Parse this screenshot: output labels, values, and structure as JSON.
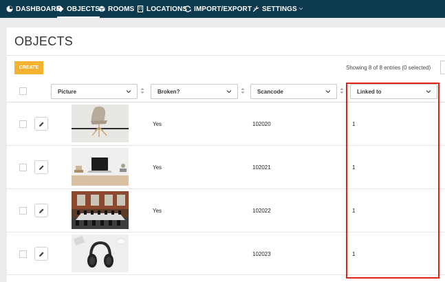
{
  "nav": {
    "items": [
      {
        "label": "DASHBOARD",
        "icon": "dashboard-icon"
      },
      {
        "label": "OBJECTS",
        "icon": "tag-icon",
        "active": true
      },
      {
        "label": "ROOMS",
        "icon": "cube-icon"
      },
      {
        "label": "LOCATIONS",
        "icon": "building-icon"
      },
      {
        "label": "IMPORT/EXPORT",
        "icon": "sync-icon",
        "dropdown": true
      },
      {
        "label": "SETTINGS",
        "icon": "wrench-icon",
        "dropdown": true
      }
    ],
    "background": "#0e3a4f"
  },
  "page": {
    "title": "OBJECTS",
    "create_label": "CREATE",
    "entries_text": "Showing 8 of 8 entries (0 selected)"
  },
  "table": {
    "columns": [
      {
        "label": "Picture"
      },
      {
        "label": "Broken?"
      },
      {
        "label": "Scancode"
      },
      {
        "label": "Linked to"
      }
    ],
    "rows": [
      {
        "picture": "chair",
        "broken": "Yes",
        "scancode": "102020",
        "linked_to": "1"
      },
      {
        "picture": "laptop",
        "broken": "Yes",
        "scancode": "102021",
        "linked_to": "1"
      },
      {
        "picture": "meeting-room",
        "broken": "Yes",
        "scancode": "102022",
        "linked_to": "1"
      },
      {
        "picture": "headphones",
        "broken": "",
        "scancode": "102023",
        "linked_to": "1"
      }
    ]
  },
  "colors": {
    "accent": "#f5b230",
    "highlight": "#e2231a"
  }
}
